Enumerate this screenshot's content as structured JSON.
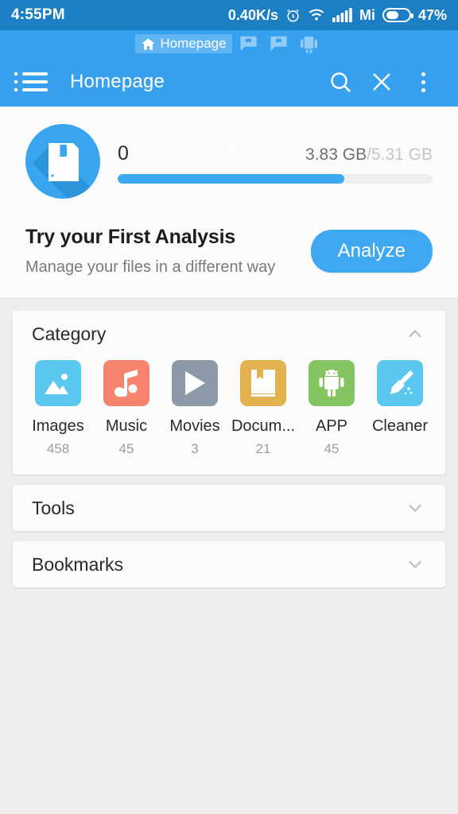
{
  "statusbar": {
    "time": "4:55PM",
    "network_speed": "0.40K/s",
    "alarm_icon": "alarm-clock-icon",
    "wifi_icon": "wifi-icon",
    "signal_icon": "cellular-signal-icon",
    "carrier": "Mi",
    "battery_icon": "battery-icon",
    "battery_percent": "47%",
    "bg_color": "#1c7fc4"
  },
  "tabstrip": {
    "tabs": [
      {
        "label": "Homepage",
        "icon": "home-icon",
        "active": true
      },
      {
        "label": "",
        "icon": "sd-card-icon",
        "active": false
      },
      {
        "label": "",
        "icon": "sd-card-icon",
        "active": false
      },
      {
        "label": "",
        "icon": "android-device-icon",
        "active": false
      }
    ]
  },
  "toolbar": {
    "menu_icon": "list-menu-icon",
    "title": "Homepage",
    "resize_handle_icon": "resize-triangle-icon",
    "search_icon": "search-icon",
    "close_icon": "close-icon",
    "overflow_icon": "more-vertical-icon",
    "bg_color": "#37a1f0"
  },
  "storage": {
    "disk_icon": "floppy-disk-icon",
    "name": "0",
    "used": "3.83 GB",
    "separator": "/",
    "total": "5.31 GB",
    "percent_used": 72,
    "accent_color": "#3ea8f0",
    "promo_title": "Try your First Analysis",
    "promo_subtitle": "Manage your files in a different way",
    "analyze_label": "Analyze"
  },
  "sections": [
    {
      "title": "Category",
      "expanded": true,
      "chevron_icon": "chevron-up-icon"
    },
    {
      "title": "Tools",
      "expanded": false,
      "chevron_icon": "chevron-down-icon"
    },
    {
      "title": "Bookmarks",
      "expanded": false,
      "chevron_icon": "chevron-down-icon"
    }
  ],
  "categories": [
    {
      "label": "Images",
      "count": "458",
      "icon": "image-icon",
      "color": "#5ac8ee"
    },
    {
      "label": "Music",
      "count": "45",
      "icon": "music-note-icon",
      "color": "#f5836e"
    },
    {
      "label": "Movies",
      "count": "3",
      "icon": "play-icon",
      "color": "#8c9aa8"
    },
    {
      "label": "Docum...",
      "count": "21",
      "icon": "book-icon",
      "color": "#e3b champ"
    },
    {
      "label": "APP",
      "count": "45",
      "icon": "android-icon",
      "color": "#84c561"
    },
    {
      "label": "Cleaner",
      "count": "",
      "icon": "broom-icon",
      "color": "#5ac8ee"
    }
  ]
}
